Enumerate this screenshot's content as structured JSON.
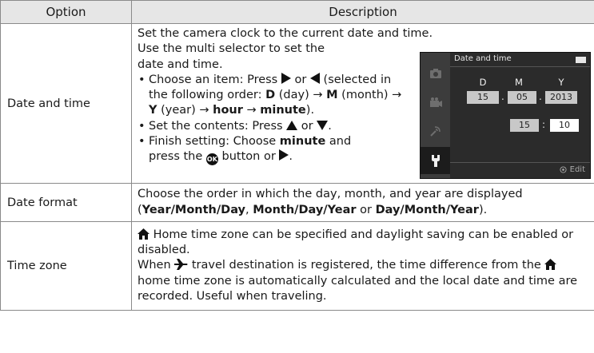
{
  "table": {
    "headers": {
      "option": "Option",
      "description": "Description"
    },
    "rows": {
      "date_time": {
        "option": "Date and time",
        "line1": "Set the camera clock to the current date and time.",
        "line2": "Use the multi selector to set the date and time.",
        "b1_a": "Choose an item: Press",
        "b1_or": "or",
        "b1_b": "(selected in the following order:",
        "b1_D": "D",
        "b1_day": "(day) →",
        "b1_M": "M",
        "b1_month": "(month) →",
        "b1_Y": "Y",
        "b1_year": "(year) →",
        "b1_hour": "hour",
        "b1_arrow": "→",
        "b1_minute": "minute",
        "b1_end": ").",
        "b2_a": "Set the contents: Press",
        "b2_or": "or",
        "b2_end": ".",
        "b3_a": "Finish setting: Choose",
        "b3_minute": "minute",
        "b3_and": "and",
        "b3_press": "press the",
        "b3_button": "button or",
        "b3_end": "."
      },
      "date_format": {
        "option": "Date format",
        "text1": "Choose the order in which the day, month, and year are displayed",
        "open": "(",
        "f1": "Year/Month/Day",
        "comma": ",",
        "f2": "Month/Day/Year",
        "or": "or",
        "f3": "Day/Month/Year",
        "close": ")."
      },
      "time_zone": {
        "option": "Time zone",
        "l1": "Home time zone can be specified and daylight saving can be enabled or disabled.",
        "l2a": "When",
        "l2b": "travel destination is registered, the time difference from the",
        "l2c": "home time zone is automatically calculated and the local date and time are recorded. Useful when traveling."
      }
    }
  },
  "camera_screen": {
    "title": "Date and time",
    "labels": {
      "d": "D",
      "m": "M",
      "y": "Y"
    },
    "day": "15",
    "month": "05",
    "year": "2013",
    "hour": "15",
    "minute": "10",
    "date_sep": ".",
    "time_sep": ":",
    "edit": "Edit",
    "ok_glyph": "OK",
    "colors": {
      "screen_bg": "#2b2b2b",
      "sidebar_bg": "#3c3c3c",
      "field_bg": "#c8c8c8",
      "active_field_bg": "#ffffff"
    },
    "icons": [
      "camera-icon",
      "movie-icon",
      "wireless-icon",
      "wrench-icon",
      "battery-icon",
      "dial-icon"
    ]
  },
  "icons": {
    "right": "triangle-right-icon",
    "left": "triangle-left-icon",
    "up": "triangle-up-icon",
    "down": "triangle-down-icon",
    "ok": "ok-button-icon",
    "home": "home-icon",
    "plane": "airplane-icon"
  }
}
